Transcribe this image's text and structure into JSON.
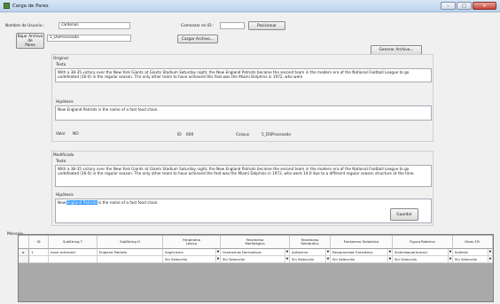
{
  "window": {
    "title": "Carga de Pares",
    "minimize": "–",
    "maximize": "□",
    "close": "✕",
    "icon": "form-app-icon"
  },
  "user": {
    "label": "Nombre de Usuario :",
    "value": "cardenas"
  },
  "start": {
    "label": "Comenzar en ID :",
    "value": "",
    "button": "Posicionar"
  },
  "load_pairs": {
    "button": "Bajar Archivo de\nPares",
    "file_name": "5_DSProcesado",
    "load_file_button": "Cargar Archivo..."
  },
  "generate_button": "Generar Archivo...",
  "original": {
    "section_label": "Original",
    "text_label": "Texto",
    "text": "With a 38-35 victory over the New York Giants at Giants Stadium Saturday night, the New England Patriots became the second team in the modern era of the National Football League to go undefeated (16-0) in the regular season. The only other team to have achieved this feat was the Miami Dolphins in 1972, who were",
    "hypothesis_label": "Hipótesis",
    "hypothesis": "New England Patriots is the name of a fast food chain.",
    "valor_label": "Valor",
    "valor": "NO",
    "id_label": "ID",
    "id": "600",
    "corpus_label": "Corpus",
    "corpus": "5_DSProcesado"
  },
  "modified": {
    "section_label": "Modificado",
    "text_label": "Texto",
    "text": "With a 38-35 victory over the New York Giants at Giants Stadium Saturday night, the New England Patriots became the second team in the modern era of the National Football League to go undefeated (16-0) in the regular season. The only other team to have achieved the feat was the Miami Dolphins in 1972, who went 14-0 due to a different regular season structure at the time.",
    "hypothesis_label": "Hipótesis",
    "hypothesis_prefix": "New ",
    "hypothesis_selected": "England Patriots",
    "hypothesis_suffix": " is the name of a fast food chain.",
    "save_button": "Guardar"
  },
  "message_label": "Mensaje",
  "grid": {
    "columns": [
      "ID",
      "SubString T",
      "SubString H",
      "Fenómeno\nLéxico",
      "Fenómeno\nMorfológico",
      "Fenómeno\nSemántico",
      "Fenómeno Sintáctico",
      "Figura Retórica",
      "Otras F.R."
    ],
    "rows": [
      {
        "marker": "▸",
        "id": "1",
        "t": "have achieved",
        "h": "England Patriots",
        "lex": "Anglicismo",
        "morf": "Gramemas Derivativos",
        "sem": "Antónimo",
        "sint": "Reciprocidad Gramática",
        "fig": "Sinécdoque(macro)",
        "otras": "Epítesis"
      },
      {
        "marker": "",
        "id": "",
        "t": "",
        "h": "",
        "lex": "Sin Selección",
        "morf": "Sin Selección",
        "sem": "Sin Selección",
        "sint": "Sin Selección",
        "fig": "Sin Selección",
        "otras": "Sin Selección"
      }
    ],
    "dropdown_arrow": "▼"
  }
}
